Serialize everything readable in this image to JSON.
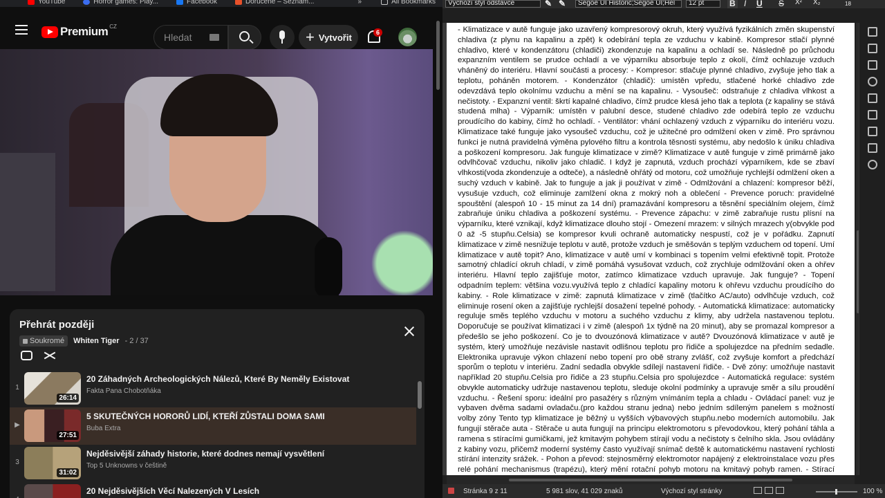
{
  "browser": {
    "bookmarks": [
      {
        "label": "YouTube",
        "color": "#ff0000"
      },
      {
        "label": "Horror games: Play...",
        "color": "#3b6df0"
      },
      {
        "label": "Facebook",
        "color": "#1877f2"
      },
      {
        "label": "Doručené – Seznam...",
        "color": "#e8512a"
      }
    ],
    "more": "»",
    "all_bookmarks": "All Bookmarks"
  },
  "youtube": {
    "logo_text": "Premium",
    "logo_region": "CZ",
    "search_placeholder": "Hledat",
    "create_label": "Vytvořit",
    "notification_count": "6",
    "playlist": {
      "title": "Přehrát později",
      "privacy": "Soukromé",
      "owner": "Whiten Tiger",
      "position": "- 2 / 37",
      "items": [
        {
          "index": "1",
          "title": "20 Záhadných Archeologických Nálezů, Které By Neměly Existovat",
          "channel": "Fakta Pana Chobotňáka",
          "duration": "26:14",
          "thumb": "#7a6a55"
        },
        {
          "index": "▶",
          "title": "5 SKUTEČNÝCH HORORŮ LIDÍ, KTEŘÍ ZŮSTALI DOMA SAMI",
          "channel": "Buba Extra",
          "duration": "27:51",
          "thumb": "#5a2e2e"
        },
        {
          "index": "3",
          "title": "Nejděsivější záhady historie, které dodnes nemají vysvětlení",
          "channel": "Top 5 Unknowns v češtině",
          "duration": "31:02",
          "thumb": "#6f6a52"
        },
        {
          "index": "4",
          "title": "20 Nejděsivějších Věcí Nalezených V Lesích",
          "channel": "",
          "duration": "",
          "thumb": "#4a3a3a"
        }
      ]
    }
  },
  "writer": {
    "paragraph_style": "Výchozí styl odstavce",
    "font_name": "Segoe UI Historic;Segoe UI;Hel",
    "font_size": "12 pt",
    "bold": "B",
    "italic": "I",
    "underline": "U",
    "strike": "S",
    "super": "X²",
    "sub": "X₂",
    "ruler_end": "18",
    "body": "- Klimatizace v autě funguje jako uzavřený kompresorový okruh, který využívá fyzikálních změn skupenství chladiva (z plynu na kapalinu a zpět) k odebírání tepla ze vzduchu v kabině. Kompresor stlačí plynné chladivo, které v kondenzátoru (chladiči) zkondenzuje na kapalinu a ochladí se. Následně po průchodu expanzním ventilem se prudce ochladí a ve výparníku absorbuje teplo z okolí, čímž ochlazuje vzduch vháněný do interiéru. Hlavní součásti a procesy: - Kompresor: stlačuje plynné chladivo, zvyšuje jeho tlak a teplotu, poháněn motorem. - Kondenzátor (chladič): umístěn vpředu, stlačené horké chladivo zde odevzdává teplo okolnímu vzduchu a mění se na kapalinu. - Vysoušeč: odstraňuje z chladiva vlhkost a nečistoty. - Expanzní ventil: škrtí kapalné chladivo, čímž prudce klesá jeho tlak a teplota (z kapaliny se stává studená mlha) - Výparník: umístěn v palubní desce, studené chladivo zde odebírá teplo ze vzduchu proudícího do kabiny, čímž ho ochladí. - Ventilátor: vhání ochlazený vzduch z výparníku do interiéru vozu. Klimatizace také funguje jako vysoušeč vzduchu, což je užitečné pro odmlžení oken v zimě. Pro správnou funkci je nutná pravidelná výměna pylového filtru a kontrola těsnosti systému, aby nedošlo k úniku chladiva a poškození kompresoru. Jak funguje klimatizace v zimě? Klimatizace v autě funguje v zimě primárně jako odvlhčovač vzduchu, nikoliv jako chladič. I když je zapnutá, vzduch prochází výparníkem, kde se zbaví vlhkosti(voda zkondenzuje a odteče), a následně ohřátý od motoru, což umožňuje rychlejší odmlžení oken a suchý vzduch v kabině. Jak to funguje a jak ji používat v zimě - Odmlžování a chlazení: kompresor běží, vysušuje vzduch, což eliminuje zamlžení okna z mokrý noh a oblečení - Prevence poruch: pravidelné spouštění (alespoň 10 - 15 minut za 14 dní) pramazávání kompresoru a těsnění speciálním olejem, čímž zabraňuje úniku chladiva a poškození systému. - Prevence zápachu: v zimě zabraňuje rustu plísní na výparníku, které vznikají, když klimatizace dlouho stojí - Omezení mrazem: v silných mrazech y(obvykle pod 0 až -5 stupňu.Celsia) se kompresor kvuli ochraně automaticky nespustí, což je v pořádku. Zapnutí klimatizace v zimě nesnižuje teplotu v autě, protože vzduch je směšován s teplým vzduchem od topení. Umí klimatizace v autě topit? Ano, klimatizace v autě umí v kombinaci s topením velmi efektivně topit. Protože samotný chladící okruh chladí, v zimě pomáhá vysušovat vzduch, což zrychluje odmlžování oken a ohřev interiéru. Hlavní teplo zajišťuje motor, zatímco klimatizace vzduch upravuje. Jak funguje? - Topení odpadním teplem: většina vozu.využívá teplo z chladící kapaliny motoru k ohřevu vzduchu proudícího do kabiny. - Role klimatizace v zimě: zapnutá klimatizace v zimě (tlačítko AC/auto) odvlhčuje vzduch, což eliminuje rosení oken a zajišťuje rychlejší dosažení tepelné pohody. - Automatická klimatizace: automaticky reguluje směs teplého vzduchu v motoru a suchého vzduchu z klimy, aby udržela nastavenou teplotu. Doporučuje se používat klimatizaci i v zimě (alespoň 1x týdně na 20 minut), aby se promazal kompresor a předešlo se jeho poškození. Co je to dvouzónová klimatizace v autě? Dvouzónová klimatizace v autě je systém, který umožňuje nezávisle nastavit odlišnou teplotu pro řidiče a spolujezdce na předním sedadle. Elektronika upravuje výkon chlazení nebo topení pro obě strany zvlášť, což zvyšuje komfort a předchází sporům o teplotu v interiéru. Zadní sedadla obvykle sdílejí nastavení řidiče. - Dvě zóny: umožňuje nastavit například 20 stupňu.Celsia pro řidiče a 23 stupňu.Celsia pro spolujezdce - Automatická regulace: systém obvykle automaticky udržuje nastavenou teplotu, sleduje okolní podmínky a upravuje směr a sílu proudění vzduchu. - Řešení sporu: ideální pro pasažéry s různým vnímáním tepla a chladu - Ovládací panel: vuz je vybaven dvěma sadami ovladaču.(pro každou stranu jedna) nebo jedním sdíleným panelem s možností volby zóny Tento typ klimatizace je běžný u vyšších výbavových stupňu.nebo moderních automobilu. Jak fungují stěrače auta - Stěrače u auta fungují na principu elektromotoru s převodovkou, který pohání táhla a ramena s stíracími gumičkami, jež kmitavým pohybem stírají vodu a nečistoty s čelního skla. Jsou ovládány z kabiny vozu, přičemž moderní systémy často využívají snímač deště k automatickému nastavení rychlosti stírání intenzity srážek. - Pohon a převod: stejnosměrný elektromotor napájený z elektroinstalace vozu přes relé pohání mechanismus (trapézu), který mění rotační pohyb motoru na kmitavý pohyb ramen. - Stírací ramena a lišty: ramena jsou opatřena přítlačnými pružinami, která zajišťují,",
    "status": {
      "page": "Stránka 9 z 11",
      "words": "5 981 slov, 41 029 znaků",
      "style": "Výchozí styl stránky",
      "zoom": "100 %",
      "zoom_value": 100
    }
  }
}
